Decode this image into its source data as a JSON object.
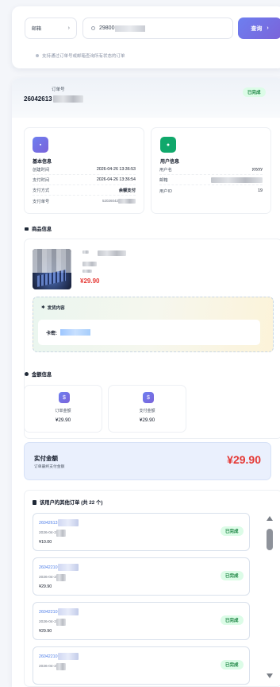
{
  "search": {
    "type_label": "邮箱",
    "input_value": "29800",
    "button_label": "查询",
    "hint": "支持通过订单号或邮箱查询所有状态的订单"
  },
  "order": {
    "label": "订单号",
    "number": "26042613",
    "status": "已完成"
  },
  "basic_info": {
    "title": "基本信息",
    "rows": [
      {
        "label": "创建时间",
        "value": "2026-04-26 13:36:53"
      },
      {
        "label": "支付时间",
        "value": "2026-04-26 13:36:54"
      },
      {
        "label": "支付方式",
        "value": "余额支付"
      },
      {
        "label": "支付单号",
        "value": "52026042"
      }
    ]
  },
  "user_info": {
    "title": "用户信息",
    "rows": [
      {
        "label": "用户名",
        "value": "yyyyy"
      },
      {
        "label": "邮箱",
        "value": ""
      },
      {
        "label": "用户ID",
        "value": "19"
      }
    ]
  },
  "product": {
    "section_title": "商品信息",
    "price": "¥29.90",
    "delivery_title": "发货内容",
    "card_key_label": "卡密:"
  },
  "amounts": {
    "section_title": "金额信息",
    "order_amount_label": "订单金额",
    "order_amount": "¥29.90",
    "pay_amount_label": "支付金额",
    "pay_amount": "¥29.90"
  },
  "paid": {
    "title": "实付金额",
    "subtitle": "订单最终支付金额",
    "amount": "¥29.90"
  },
  "other_orders": {
    "title": "该用户的其他订单 (共 22 个)",
    "items": [
      {
        "no": "26042613",
        "date": "2026-04-2",
        "price": "¥10.00",
        "status": "已完成"
      },
      {
        "no": "26042210",
        "date": "2026-04-2",
        "price": "¥29.90",
        "status": "已完成"
      },
      {
        "no": "26042210",
        "date": "2026-04-2",
        "price": "¥29.90",
        "status": "已完成"
      },
      {
        "no": "26042210",
        "date": "2026-04-2",
        "price": "",
        "status": "已完成"
      }
    ]
  },
  "colors": {
    "accent": "#6d7ff0",
    "price_red": "#e53935",
    "success_bg": "#dcfce7",
    "success_text": "#15803d"
  }
}
